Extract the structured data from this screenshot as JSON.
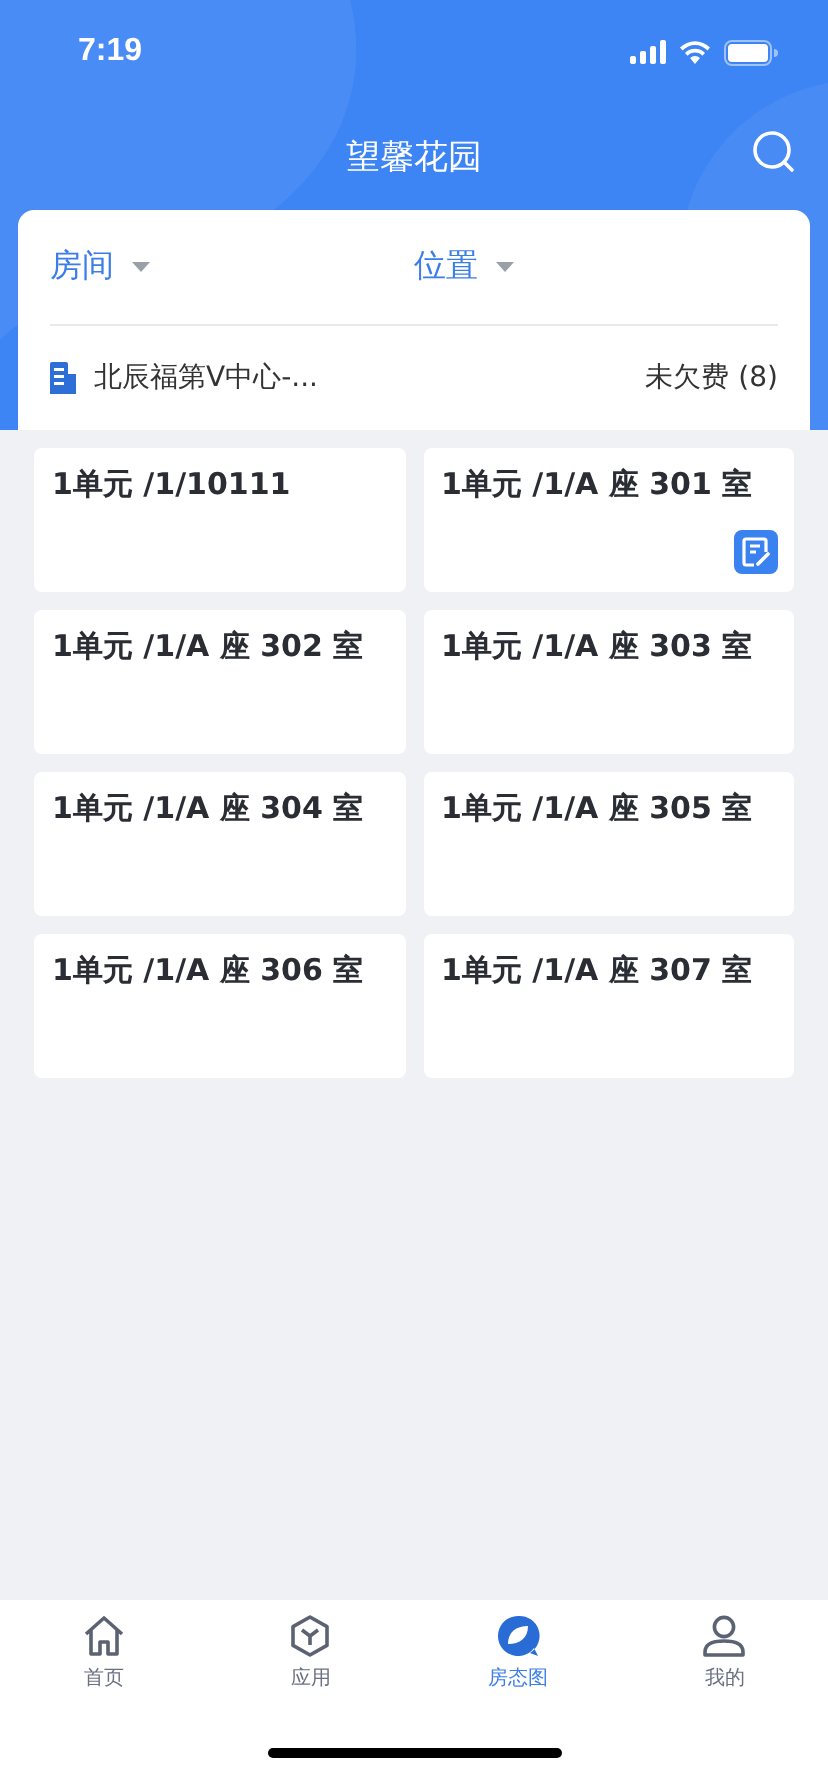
{
  "status_bar": {
    "time": "7:19"
  },
  "header": {
    "title": "望馨花园"
  },
  "filters": [
    {
      "label": "房间"
    },
    {
      "label": "位置"
    }
  ],
  "location": {
    "name": "北辰福第Ⅴ中心-...",
    "status": "未欠费 (8)"
  },
  "rooms": [
    {
      "name": "1单元 /1/10111",
      "flagged": false
    },
    {
      "name": "1单元 /1/A 座 301 室",
      "flagged": true
    },
    {
      "name": "1单元 /1/A 座 302 室",
      "flagged": false
    },
    {
      "name": "1单元 /1/A 座 303 室",
      "flagged": false
    },
    {
      "name": "1单元 /1/A 座 304 室",
      "flagged": false
    },
    {
      "name": "1单元 /1/A 座 305 室",
      "flagged": false
    },
    {
      "name": "1单元 /1/A 座 306 室",
      "flagged": false
    },
    {
      "name": "1单元 /1/A 座 307 室",
      "flagged": false
    }
  ],
  "tab_bar": [
    {
      "label": "首页",
      "kind": "home",
      "selected": false
    },
    {
      "label": "应用",
      "kind": "apps",
      "selected": false
    },
    {
      "label": "房态图",
      "kind": "rooms",
      "selected": true
    },
    {
      "label": "我的",
      "kind": "profile",
      "selected": false
    }
  ]
}
